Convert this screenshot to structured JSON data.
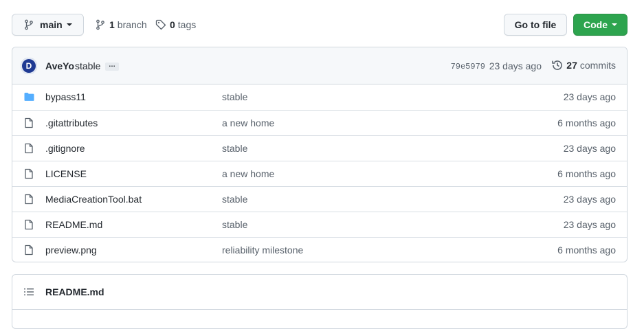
{
  "toolbar": {
    "branch_name": "main",
    "branches_count": "1",
    "branches_label": "branch",
    "tags_count": "0",
    "tags_label": "tags",
    "goto_label": "Go to file",
    "code_label": "Code"
  },
  "commit": {
    "avatar_letter": "D",
    "author": "AveYo",
    "message": "stable",
    "more": "…",
    "sha": "79e5979",
    "age": "23 days ago",
    "commits_count": "27",
    "commits_label": "commits"
  },
  "files": [
    {
      "type": "folder",
      "name": "bypass11",
      "message": "stable",
      "age": "23 days ago"
    },
    {
      "type": "file",
      "name": ".gitattributes",
      "message": "a new home",
      "age": "6 months ago"
    },
    {
      "type": "file",
      "name": ".gitignore",
      "message": "stable",
      "age": "23 days ago"
    },
    {
      "type": "file",
      "name": "LICENSE",
      "message": "a new home",
      "age": "6 months ago"
    },
    {
      "type": "file",
      "name": "MediaCreationTool.bat",
      "message": "stable",
      "age": "23 days ago"
    },
    {
      "type": "file",
      "name": "README.md",
      "message": "stable",
      "age": "23 days ago"
    },
    {
      "type": "file",
      "name": "preview.png",
      "message": "reliability milestone",
      "age": "6 months ago"
    }
  ],
  "readme": {
    "title": "README.md"
  },
  "colors": {
    "accent_green": "#2da44e",
    "folder_blue": "#54aeff",
    "border": "#d0d7de"
  }
}
